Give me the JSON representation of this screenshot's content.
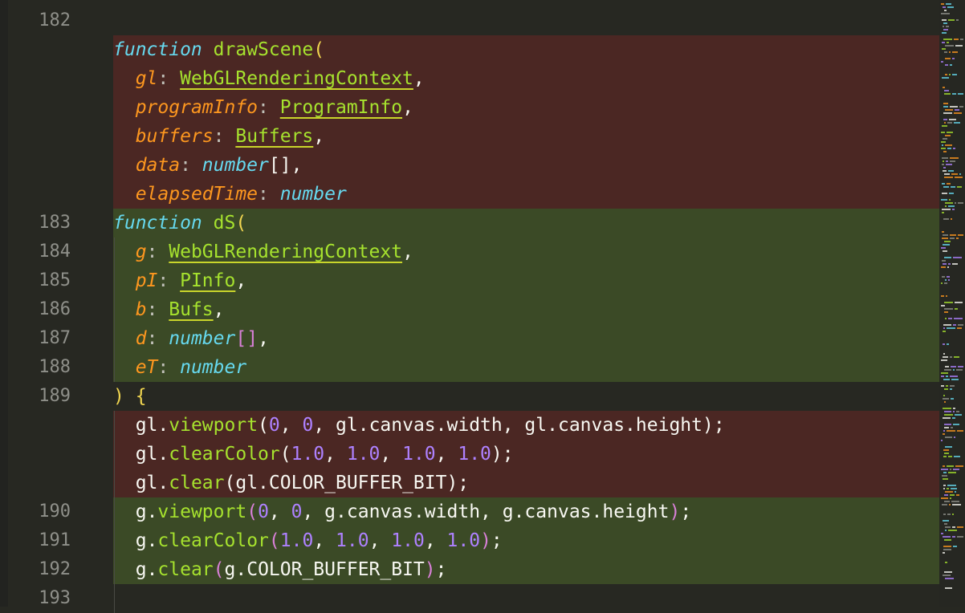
{
  "colors": {
    "background": "#272822",
    "removed_line": "#4b2723",
    "added_line": "#3b4a26"
  },
  "lines": [
    {
      "type": "normal",
      "num": "182",
      "tokens": []
    },
    {
      "type": "removed",
      "num": "",
      "tokens": [
        {
          "t": "function",
          "c": "kw"
        },
        {
          "t": " ",
          "c": "plain"
        },
        {
          "t": "drawScene",
          "c": "fn"
        },
        {
          "t": "(",
          "c": "br-y"
        }
      ]
    },
    {
      "type": "removed",
      "num": "",
      "tokens": [
        {
          "t": "  ",
          "c": "plain"
        },
        {
          "t": "gl",
          "c": "param"
        },
        {
          "t": ": ",
          "c": "punc-dim"
        },
        {
          "t": "WebGLRenderingContext",
          "c": "typ"
        },
        {
          "t": ",",
          "c": "punc"
        }
      ]
    },
    {
      "type": "removed",
      "num": "",
      "tokens": [
        {
          "t": "  ",
          "c": "plain"
        },
        {
          "t": "programInfo",
          "c": "param"
        },
        {
          "t": ": ",
          "c": "punc-dim"
        },
        {
          "t": "ProgramInfo",
          "c": "typ"
        },
        {
          "t": ",",
          "c": "punc"
        }
      ]
    },
    {
      "type": "removed",
      "num": "",
      "tokens": [
        {
          "t": "  ",
          "c": "plain"
        },
        {
          "t": "buffers",
          "c": "param"
        },
        {
          "t": ": ",
          "c": "punc-dim"
        },
        {
          "t": "Buffers",
          "c": "typ"
        },
        {
          "t": ",",
          "c": "punc"
        }
      ]
    },
    {
      "type": "removed",
      "num": "",
      "tokens": [
        {
          "t": "  ",
          "c": "plain"
        },
        {
          "t": "data",
          "c": "param"
        },
        {
          "t": ": ",
          "c": "punc-dim"
        },
        {
          "t": "number",
          "c": "prim"
        },
        {
          "t": "[],",
          "c": "punc"
        }
      ]
    },
    {
      "type": "removed",
      "num": "",
      "tokens": [
        {
          "t": "  ",
          "c": "plain"
        },
        {
          "t": "elapsedTime",
          "c": "param"
        },
        {
          "t": ": ",
          "c": "punc-dim"
        },
        {
          "t": "number",
          "c": "prim"
        }
      ]
    },
    {
      "type": "added",
      "num": "183",
      "tokens": [
        {
          "t": "function",
          "c": "kw"
        },
        {
          "t": " ",
          "c": "plain"
        },
        {
          "t": "dS",
          "c": "fn"
        },
        {
          "t": "(",
          "c": "br-y"
        }
      ]
    },
    {
      "type": "added",
      "num": "184",
      "tokens": [
        {
          "t": "  ",
          "c": "plain"
        },
        {
          "t": "g",
          "c": "param"
        },
        {
          "t": ": ",
          "c": "punc-dim"
        },
        {
          "t": "WebGLRenderingContext",
          "c": "typ"
        },
        {
          "t": ",",
          "c": "punc"
        }
      ]
    },
    {
      "type": "added",
      "num": "185",
      "tokens": [
        {
          "t": "  ",
          "c": "plain"
        },
        {
          "t": "pI",
          "c": "param"
        },
        {
          "t": ": ",
          "c": "punc-dim"
        },
        {
          "t": "PInfo",
          "c": "typ"
        },
        {
          "t": ",",
          "c": "punc"
        }
      ]
    },
    {
      "type": "added",
      "num": "186",
      "tokens": [
        {
          "t": "  ",
          "c": "plain"
        },
        {
          "t": "b",
          "c": "param"
        },
        {
          "t": ": ",
          "c": "punc-dim"
        },
        {
          "t": "Bufs",
          "c": "typ"
        },
        {
          "t": ",",
          "c": "punc"
        }
      ]
    },
    {
      "type": "added",
      "num": "187",
      "tokens": [
        {
          "t": "  ",
          "c": "plain"
        },
        {
          "t": "d",
          "c": "param"
        },
        {
          "t": ": ",
          "c": "punc-dim"
        },
        {
          "t": "number",
          "c": "prim"
        },
        {
          "t": "[]",
          "c": "br-p"
        },
        {
          "t": ",",
          "c": "punc"
        }
      ]
    },
    {
      "type": "added",
      "num": "188",
      "tokens": [
        {
          "t": "  ",
          "c": "plain"
        },
        {
          "t": "eT",
          "c": "param"
        },
        {
          "t": ": ",
          "c": "punc-dim"
        },
        {
          "t": "number",
          "c": "prim"
        }
      ]
    },
    {
      "type": "normal",
      "num": "189",
      "tokens": [
        {
          "t": ")",
          "c": "br-y"
        },
        {
          "t": " ",
          "c": "plain"
        },
        {
          "t": "{",
          "c": "br-y"
        }
      ]
    },
    {
      "type": "removed",
      "num": "",
      "tokens": [
        {
          "t": "  ",
          "c": "plain"
        },
        {
          "t": "gl",
          "c": "plain"
        },
        {
          "t": ".",
          "c": "punc"
        },
        {
          "t": "viewport",
          "c": "member"
        },
        {
          "t": "(",
          "c": "punc"
        },
        {
          "t": "0",
          "c": "num"
        },
        {
          "t": ", ",
          "c": "punc"
        },
        {
          "t": "0",
          "c": "num"
        },
        {
          "t": ", gl.canvas.width, gl.canvas.height);",
          "c": "plain"
        }
      ]
    },
    {
      "type": "removed",
      "num": "",
      "tokens": [
        {
          "t": "  ",
          "c": "plain"
        },
        {
          "t": "gl",
          "c": "plain"
        },
        {
          "t": ".",
          "c": "punc"
        },
        {
          "t": "clearColor",
          "c": "member"
        },
        {
          "t": "(",
          "c": "punc"
        },
        {
          "t": "1.0",
          "c": "num"
        },
        {
          "t": ", ",
          "c": "punc"
        },
        {
          "t": "1.0",
          "c": "num"
        },
        {
          "t": ", ",
          "c": "punc"
        },
        {
          "t": "1.0",
          "c": "num"
        },
        {
          "t": ", ",
          "c": "punc"
        },
        {
          "t": "1.0",
          "c": "num"
        },
        {
          "t": ");",
          "c": "punc"
        }
      ]
    },
    {
      "type": "removed",
      "num": "",
      "tokens": [
        {
          "t": "  ",
          "c": "plain"
        },
        {
          "t": "gl",
          "c": "plain"
        },
        {
          "t": ".",
          "c": "punc"
        },
        {
          "t": "clear",
          "c": "member"
        },
        {
          "t": "(gl.COLOR_BUFFER_BIT);",
          "c": "plain"
        }
      ]
    },
    {
      "type": "added",
      "num": "190",
      "tokens": [
        {
          "t": "  ",
          "c": "plain"
        },
        {
          "t": "g",
          "c": "plain"
        },
        {
          "t": ".",
          "c": "punc"
        },
        {
          "t": "viewport",
          "c": "member"
        },
        {
          "t": "(",
          "c": "br-p"
        },
        {
          "t": "0",
          "c": "num"
        },
        {
          "t": ", ",
          "c": "punc"
        },
        {
          "t": "0",
          "c": "num"
        },
        {
          "t": ", g.canvas.width, g.canvas.height",
          "c": "plain"
        },
        {
          "t": ")",
          "c": "br-p"
        },
        {
          "t": ";",
          "c": "punc"
        }
      ]
    },
    {
      "type": "added",
      "num": "191",
      "tokens": [
        {
          "t": "  ",
          "c": "plain"
        },
        {
          "t": "g",
          "c": "plain"
        },
        {
          "t": ".",
          "c": "punc"
        },
        {
          "t": "clearColor",
          "c": "member"
        },
        {
          "t": "(",
          "c": "br-p"
        },
        {
          "t": "1.0",
          "c": "num"
        },
        {
          "t": ", ",
          "c": "punc"
        },
        {
          "t": "1.0",
          "c": "num"
        },
        {
          "t": ", ",
          "c": "punc"
        },
        {
          "t": "1.0",
          "c": "num"
        },
        {
          "t": ", ",
          "c": "punc"
        },
        {
          "t": "1.0",
          "c": "num"
        },
        {
          "t": ")",
          "c": "br-p"
        },
        {
          "t": ";",
          "c": "punc"
        }
      ]
    },
    {
      "type": "added",
      "num": "192",
      "tokens": [
        {
          "t": "  ",
          "c": "plain"
        },
        {
          "t": "g",
          "c": "plain"
        },
        {
          "t": ".",
          "c": "punc"
        },
        {
          "t": "clear",
          "c": "member"
        },
        {
          "t": "(",
          "c": "br-p"
        },
        {
          "t": "g.COLOR_BUFFER_BIT",
          "c": "plain"
        },
        {
          "t": ")",
          "c": "br-p"
        },
        {
          "t": ";",
          "c": "punc"
        }
      ]
    },
    {
      "type": "normal",
      "num": "193",
      "tokens": []
    }
  ]
}
